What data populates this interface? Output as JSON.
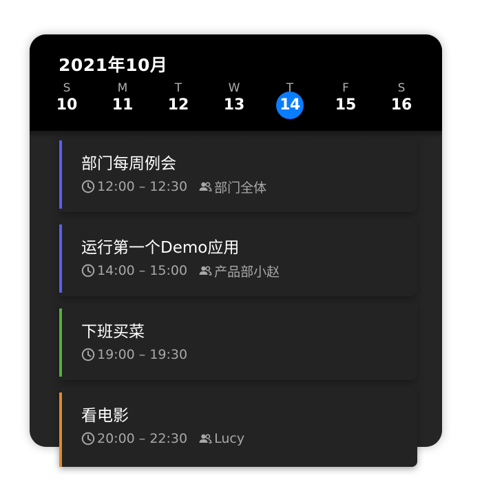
{
  "header": {
    "month_title": "2021年10月"
  },
  "week": [
    {
      "weekday": "S",
      "date": "10",
      "selected": false
    },
    {
      "weekday": "M",
      "date": "11",
      "selected": false
    },
    {
      "weekday": "T",
      "date": "12",
      "selected": false
    },
    {
      "weekday": "W",
      "date": "13",
      "selected": false
    },
    {
      "weekday": "T",
      "date": "14",
      "selected": true
    },
    {
      "weekday": "F",
      "date": "15",
      "selected": false
    },
    {
      "weekday": "S",
      "date": "16",
      "selected": false
    }
  ],
  "events": [
    {
      "title": "部门每周例会",
      "time": "12:00 – 12:30",
      "attendees": "部门全体",
      "color": "#5b5ff3"
    },
    {
      "title": "运行第一个Demo应用",
      "time": "14:00 – 15:00",
      "attendees": "产品部小赵",
      "color": "#5b5ff3"
    },
    {
      "title": "下班买菜",
      "time": "19:00 – 19:30",
      "attendees": "",
      "color": "#56b13d"
    },
    {
      "title": "看电影",
      "time": "20:00 – 22:30",
      "attendees": "Lucy",
      "color": "#e08a2e"
    }
  ],
  "colors": {
    "selected_date": "#0a7cff",
    "header_bg": "#000000",
    "body_bg": "#252525"
  },
  "icons": {
    "time": "clock-icon",
    "attendees": "people-icon"
  }
}
